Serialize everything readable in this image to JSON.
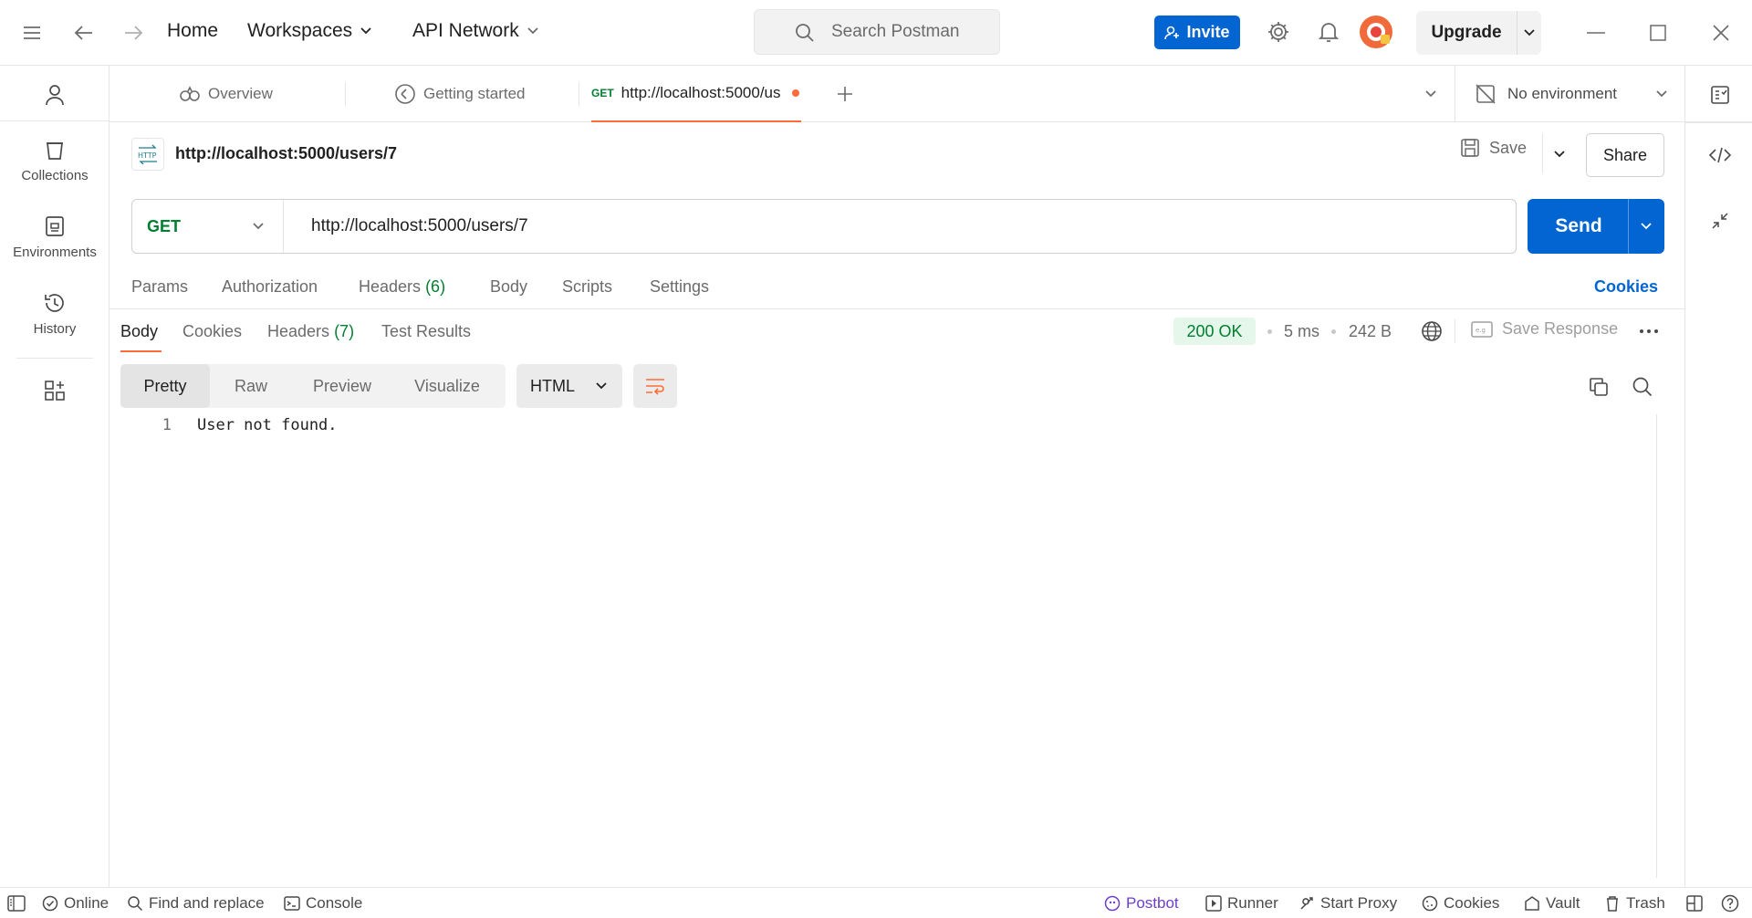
{
  "topbar": {
    "home": "Home",
    "workspaces": "Workspaces",
    "api_network": "API Network",
    "search_placeholder": "Search Postman",
    "invite": "Invite",
    "upgrade": "Upgrade"
  },
  "sidebar": {
    "items": [
      {
        "label": "Collections",
        "icon": "trash-bin-icon"
      },
      {
        "label": "Environments",
        "icon": "environment-icon"
      },
      {
        "label": "History",
        "icon": "history-icon"
      }
    ]
  },
  "tabs": {
    "overview": "Overview",
    "getting_started": "Getting started",
    "active_method": "GET",
    "active_url": "http://localhost:5000/us",
    "environment": "No environment"
  },
  "request": {
    "title": "http://localhost:5000/users/7",
    "save": "Save",
    "share": "Share",
    "method": "GET",
    "url": "http://localhost:5000/users/7",
    "send": "Send",
    "tabs": {
      "params": "Params",
      "authorization": "Authorization",
      "headers": "Headers",
      "headers_count": "(6)",
      "body": "Body",
      "scripts": "Scripts",
      "settings": "Settings",
      "cookies": "Cookies"
    }
  },
  "response": {
    "tabs": {
      "body": "Body",
      "cookies": "Cookies",
      "headers": "Headers",
      "headers_count": "(7)",
      "test_results": "Test Results"
    },
    "status": "200 OK",
    "time": "5 ms",
    "size": "242 B",
    "save_response": "Save Response",
    "views": [
      "Pretty",
      "Raw",
      "Preview",
      "Visualize"
    ],
    "format": "HTML",
    "line_number": "1",
    "body_text": "User not found."
  },
  "footer": {
    "online": "Online",
    "find_replace": "Find and replace",
    "console": "Console",
    "postbot": "Postbot",
    "runner": "Runner",
    "start_proxy": "Start Proxy",
    "cookies": "Cookies",
    "vault": "Vault",
    "trash": "Trash"
  },
  "colors": {
    "accent_blue": "#0265d2",
    "accent_orange": "#ff6c37",
    "success_green": "#007f31",
    "postbot_purple": "#6e3ec8"
  }
}
